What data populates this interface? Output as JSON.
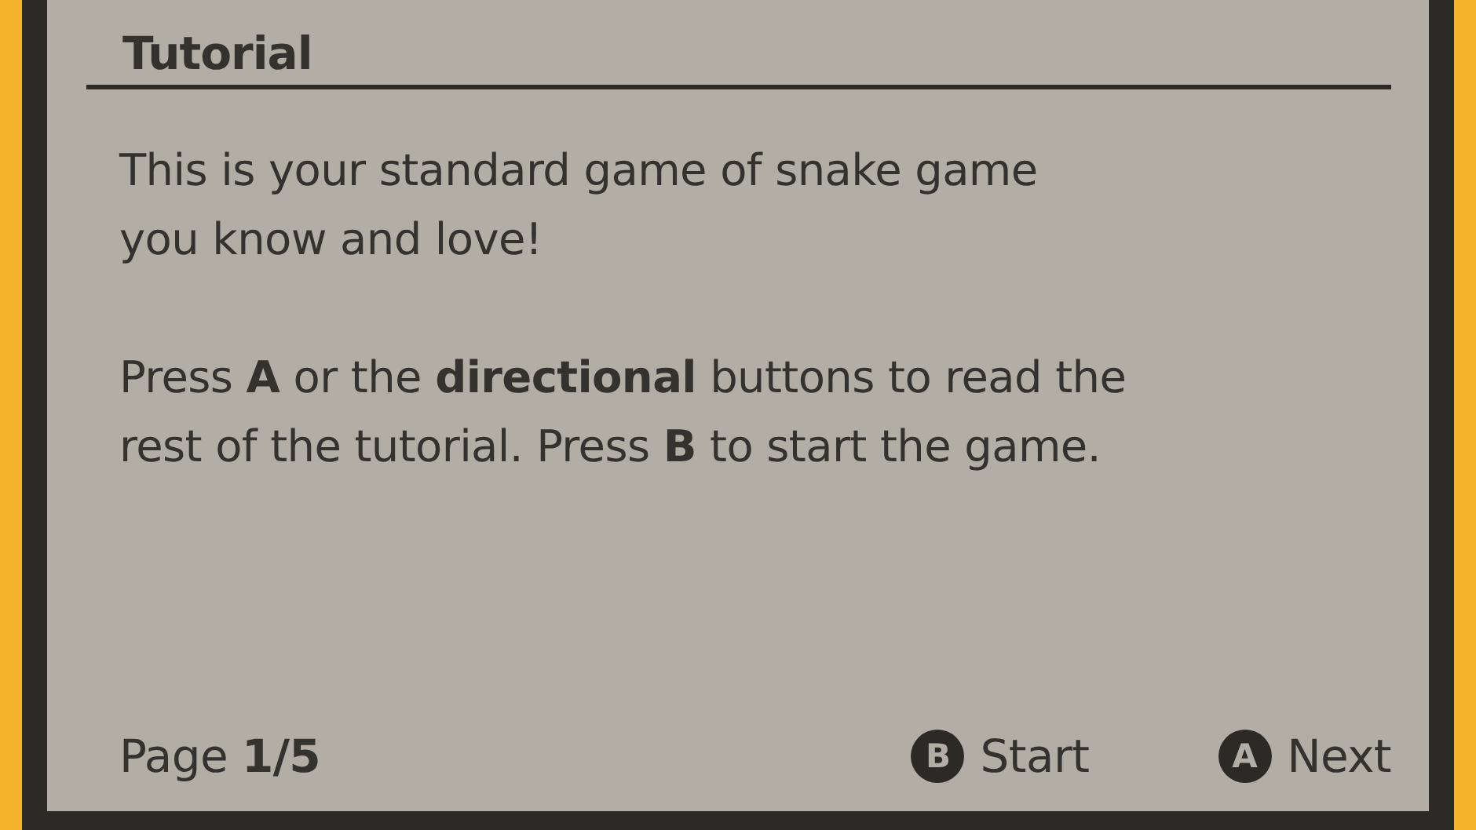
{
  "title": "Tutorial",
  "paragraphs": [
    [
      "This is your standard game of snake game",
      "you know and love!"
    ],
    [
      "Press **A** or the **directional** buttons to read the",
      "rest of the tutorial. Press **B** to start the game."
    ]
  ],
  "page": {
    "label": "Page",
    "value": "1/5"
  },
  "buttons": [
    {
      "key": "B",
      "label": "Start"
    },
    {
      "key": "A",
      "label": "Next"
    }
  ]
}
